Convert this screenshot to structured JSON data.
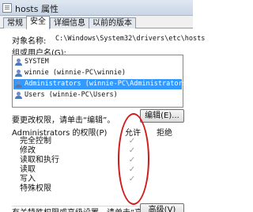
{
  "window": {
    "title": "hosts 属性"
  },
  "tabs": [
    {
      "label": "常规"
    },
    {
      "label": "安全"
    },
    {
      "label": "详细信息"
    },
    {
      "label": "以前的版本"
    }
  ],
  "object": {
    "label": "对象名称:",
    "value": "C:\\Windows\\System32\\drivers\\etc\\hosts"
  },
  "groups": {
    "label": "组或用户名(G):",
    "items": [
      {
        "label": "SYSTEM"
      },
      {
        "label": "winnie (winnie-PC\\winnie)"
      },
      {
        "label": "Administrators (winnie-PC\\Administrators)"
      },
      {
        "label": "Users (winnie-PC\\Users)"
      }
    ],
    "selected_index": 2
  },
  "edit": {
    "hint": "要更改权限，请单击“编辑”。",
    "button_label": "编辑(E)..."
  },
  "permissions": {
    "header": "Administrators 的权限(P)",
    "allow_label": "允许",
    "deny_label": "拒绝",
    "rows": [
      {
        "name": "完全控制",
        "allow": true,
        "deny": false
      },
      {
        "name": "修改",
        "allow": true,
        "deny": false
      },
      {
        "name": "读取和执行",
        "allow": true,
        "deny": false
      },
      {
        "name": "读取",
        "allow": true,
        "deny": false
      },
      {
        "name": "写入",
        "allow": true,
        "deny": false
      },
      {
        "name": "特殊权限",
        "allow": false,
        "deny": false
      }
    ]
  },
  "advanced": {
    "hint": "有关特殊权限或高级设置，请单击“高级”。",
    "button_label": "高级(V)"
  },
  "colors": {
    "selection": "#3399ff",
    "annotation": "#d11a1a"
  }
}
